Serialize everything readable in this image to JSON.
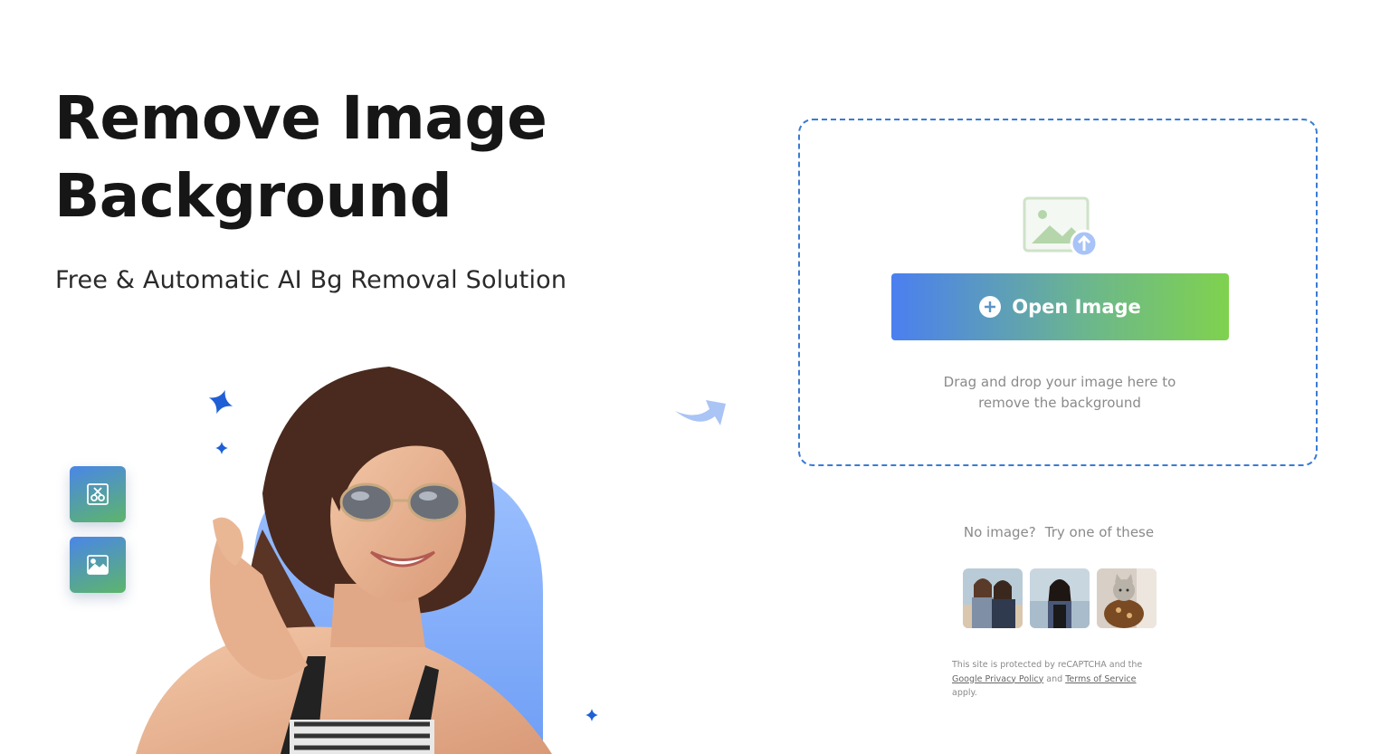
{
  "hero": {
    "title_line1": "Remove Image",
    "title_line2": "Background",
    "subtitle": "Free & Automatic AI Bg Removal Solution"
  },
  "upload": {
    "button_label": "Open Image",
    "drop_line1": "Drag and drop your image here to",
    "drop_line2": "remove the background",
    "icons": [
      "image-upload-icon",
      "plus-circle-icon"
    ]
  },
  "samples": {
    "label_part1": "No image?",
    "label_part2": "Try one of these",
    "items": [
      {
        "name": "sample-two-women"
      },
      {
        "name": "sample-woman-beach"
      },
      {
        "name": "sample-cat"
      }
    ]
  },
  "recaptcha": {
    "text1": "This site is protected by reCAPTCHA and the",
    "privacy_link": "Google Privacy Policy",
    "and": "and",
    "terms_link": "Terms of Service",
    "text2": "apply."
  },
  "tools": [
    "cutout-tool-icon",
    "image-tool-icon"
  ],
  "colors": {
    "accent_blue": "#3a7bd5",
    "gradient_start": "#4a7ff0",
    "gradient_end": "#7fd24e",
    "sparkle": "#1f5fd6"
  }
}
